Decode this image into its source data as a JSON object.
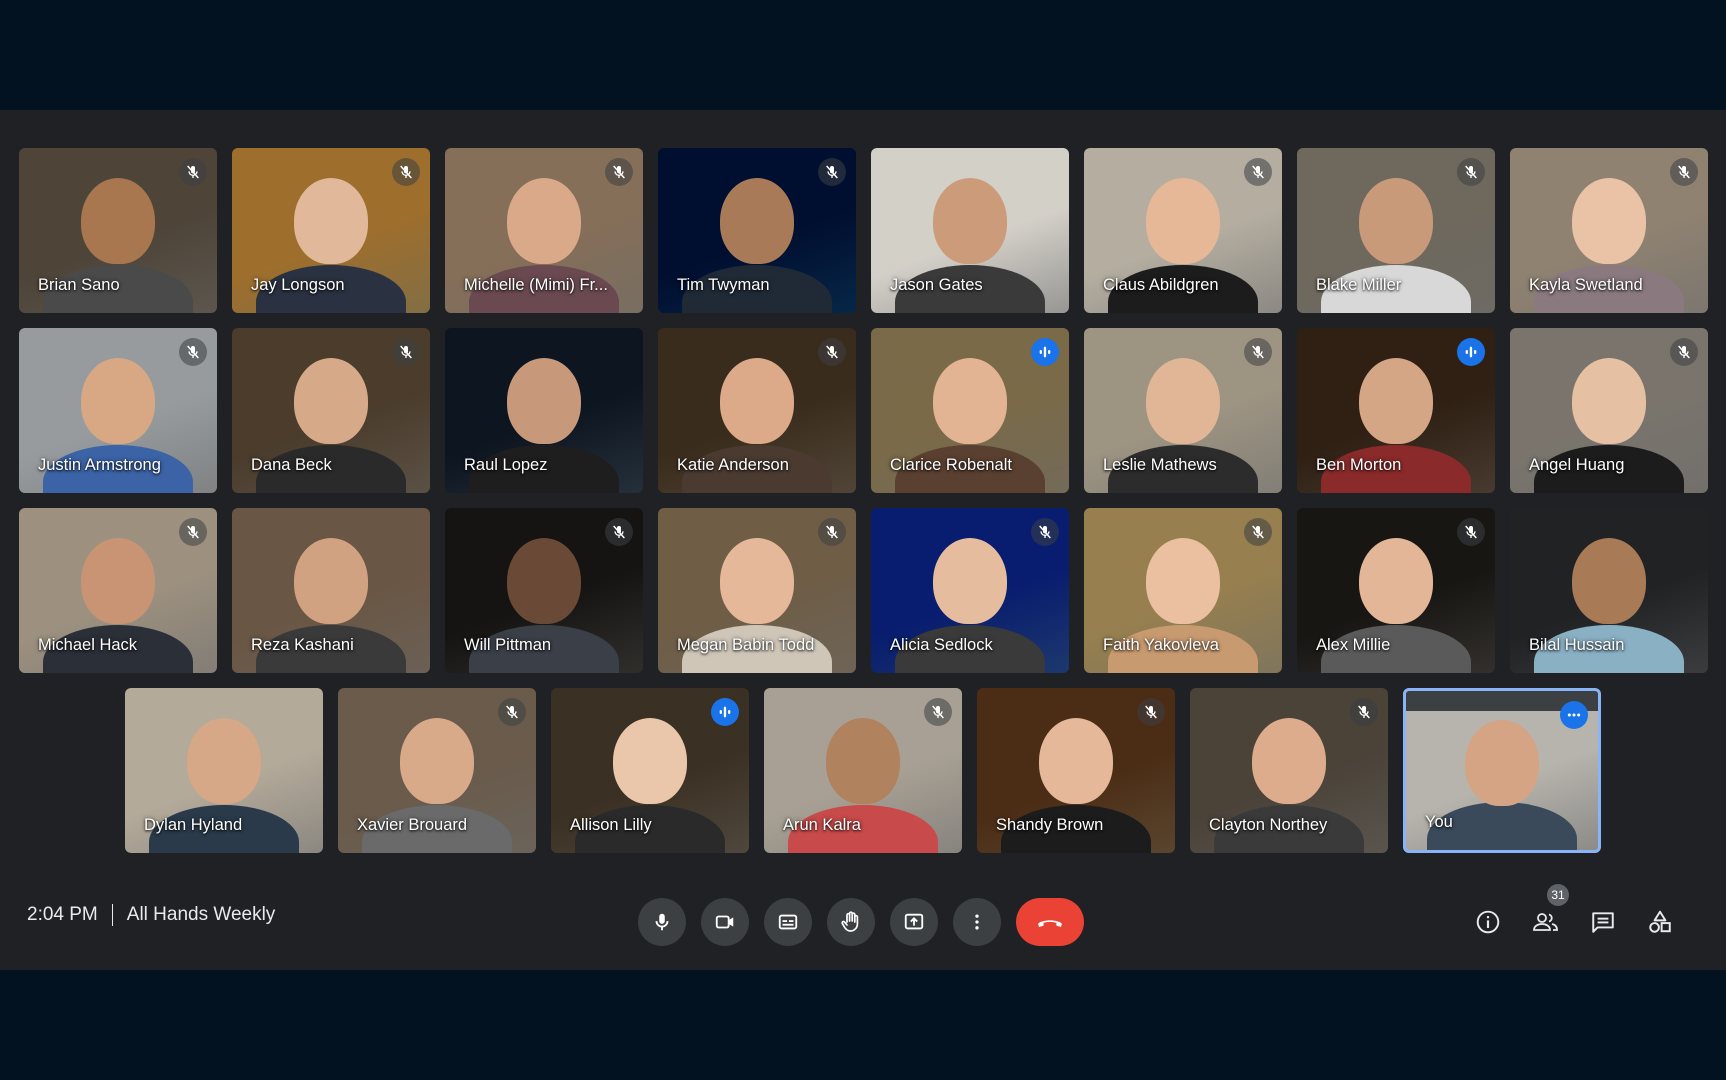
{
  "meeting": {
    "time": "2:04 PM",
    "title": "All Hands Weekly",
    "participant_count": "31"
  },
  "rows": [
    [
      {
        "name": "Brian Sano",
        "status": "muted",
        "bg": "#8d8478",
        "skin": "#a8764f",
        "shirt": "#4a4a4a"
      },
      {
        "name": "Jay Longson",
        "status": "muted",
        "bg": "#c9a86a",
        "skin": "#e2b89a",
        "shirt": "#2a3140"
      },
      {
        "name": "Michelle (Mimi) Fr...",
        "status": "muted",
        "bg": "#b8a896",
        "skin": "#d9a989",
        "shirt": "#6a4a50"
      },
      {
        "name": "Tim Twyman",
        "status": "muted",
        "bg": "#0a3c6e",
        "skin": "#a87a58",
        "shirt": "#1f2a36"
      },
      {
        "name": "Jason Gates",
        "status": "none",
        "bg": "#e8e6e2",
        "skin": "#cc9c7a",
        "shirt": "#3a3a3a"
      },
      {
        "name": "Claus Abildgren",
        "status": "muted",
        "bg": "#d6d2ca",
        "skin": "#e6b898",
        "shirt": "#1c1c1c"
      },
      {
        "name": "Blake Miller",
        "status": "muted",
        "bg": "#a8a39a",
        "skin": "#c89a7a",
        "shirt": "#d8d8d8"
      },
      {
        "name": "Kayla Swetland",
        "status": "muted",
        "bg": "#bfb6aa",
        "skin": "#eac3a6",
        "shirt": "#8a7a80"
      }
    ],
    [
      {
        "name": "Justin Armstrong",
        "status": "muted",
        "bg": "#c4c7c9",
        "skin": "#d8a884",
        "shirt": "#3b63a6"
      },
      {
        "name": "Dana Beck",
        "status": "muted",
        "bg": "#8a7c6a",
        "skin": "#d6aa88",
        "shirt": "#2a2a2a"
      },
      {
        "name": "Raul Lopez",
        "status": "none",
        "bg": "#3a4a5a",
        "skin": "#c8987a",
        "shirt": "#1e1e1e"
      },
      {
        "name": "Katie Anderson",
        "status": "muted",
        "bg": "#7a6a55",
        "skin": "#dcaa88",
        "shirt": "#4a3a30"
      },
      {
        "name": "Clarice Robenalt",
        "status": "speaking",
        "bg": "#b0a488",
        "skin": "#e2b494",
        "shirt": "#5a4030"
      },
      {
        "name": "Leslie Mathews",
        "status": "muted",
        "bg": "#c8c2b6",
        "skin": "#e0b696",
        "shirt": "#2c2c2c"
      },
      {
        "name": "Ben Morton",
        "status": "speaking",
        "bg": "#6e5a48",
        "skin": "#d4a686",
        "shirt": "#8a2a2a"
      },
      {
        "name": "Angel Huang",
        "status": "muted",
        "bg": "#b0aca6",
        "skin": "#e6c0a2",
        "shirt": "#1c1c1c"
      }
    ],
    [
      {
        "name": "Michael Hack",
        "status": "muted",
        "bg": "#c8c0b4",
        "skin": "#c89474",
        "shirt": "#2a2f38"
      },
      {
        "name": "Reza Kashani",
        "status": "none",
        "bg": "#a49484",
        "skin": "#d0a282",
        "shirt": "#3a3a3a"
      },
      {
        "name": "Will Pittman",
        "status": "muted",
        "bg": "#4a4844",
        "skin": "#6a4a36",
        "shirt": "#3a3f48"
      },
      {
        "name": "Megan Babin Todd",
        "status": "muted",
        "bg": "#a89a86",
        "skin": "#e4b898",
        "shirt": "#cfc6b8"
      },
      {
        "name": "Alicia Sedlock",
        "status": "muted",
        "bg": "#2d56a8",
        "skin": "#e6bc9e",
        "shirt": "#3a3a3a"
      },
      {
        "name": "Faith Yakovleva",
        "status": "muted",
        "bg": "#c4b48e",
        "skin": "#eac0a0",
        "shirt": "#c89a70"
      },
      {
        "name": "Alex Millie",
        "status": "muted",
        "bg": "#4e4a46",
        "skin": "#e2b696",
        "shirt": "#5a5a5a"
      },
      {
        "name": "Bilal Hussain",
        "status": "none",
        "bg": "#5a5d60",
        "skin": "#a87a56",
        "shirt": "#8ab0c4"
      }
    ],
    [
      {
        "name": "Dylan Hyland",
        "status": "none",
        "bg": "#d6d0c6",
        "skin": "#d6a888",
        "shirt": "#2a3a4a"
      },
      {
        "name": "Xavier Brouard",
        "status": "muted",
        "bg": "#a4988a",
        "skin": "#d8aa8a",
        "shirt": "#6a6a6a"
      },
      {
        "name": "Allison Lilly",
        "status": "speaking",
        "bg": "#7a6e5e",
        "skin": "#eac6aa",
        "shirt": "#2a2a2a"
      },
      {
        "name": "Arun Kalra",
        "status": "muted",
        "bg": "#cfcac2",
        "skin": "#b0825e",
        "shirt": "#c84a4a"
      },
      {
        "name": "Shandy Brown",
        "status": "muted",
        "bg": "#8a6a48",
        "skin": "#e4b898",
        "shirt": "#1c1c1c"
      },
      {
        "name": "Clayton Northey",
        "status": "muted",
        "bg": "#8a8278",
        "skin": "#dcac8c",
        "shirt": "#3a3a3a"
      },
      {
        "name": "You",
        "status": "more",
        "bg": "#d8d6d2",
        "skin": "#d4a484",
        "shirt": "#3a4a5a",
        "self": true
      }
    ]
  ]
}
